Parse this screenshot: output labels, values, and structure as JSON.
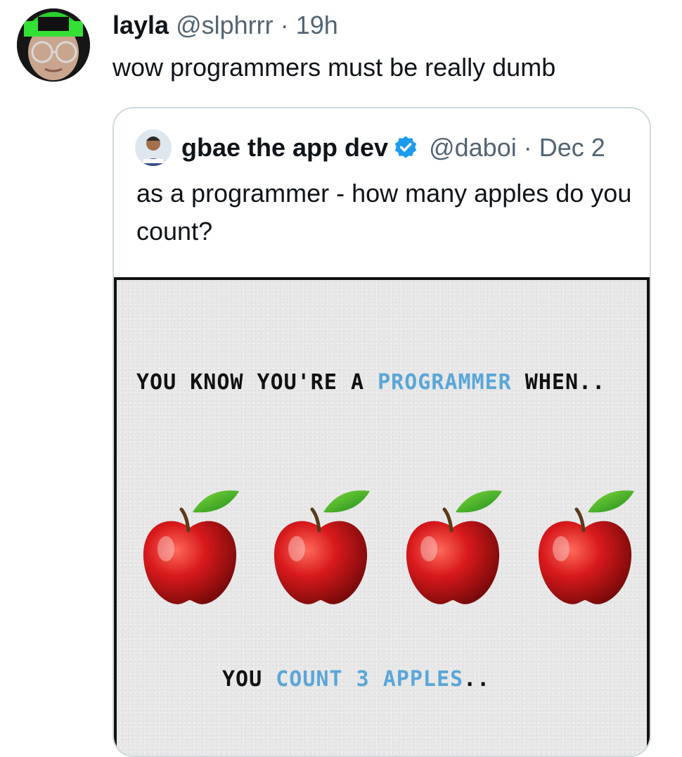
{
  "tweet": {
    "author_name": "layla",
    "author_handle": "@slphrrr",
    "separator": "·",
    "time": "19h",
    "text": "wow programmers must be really dumb"
  },
  "quote": {
    "author_name": "gbae the app dev",
    "author_handle": "@daboi",
    "separator": "·",
    "date": "Dec 2",
    "text": "as a programmer - how many apples do you count?",
    "verified": true,
    "verified_color": "#1d9bf0"
  },
  "image": {
    "headline": {
      "part1": "YOU KNOW YOU'RE A",
      "highlight": "PROGRAMMER",
      "part2": "WHEN.."
    },
    "apple_count_shown": 4,
    "footer": {
      "part1": "YOU",
      "highlight1": "COUNT",
      "highlight2": "3 APPLES",
      "part2": ".."
    },
    "highlight_color": "#5aa6d8"
  },
  "colors": {
    "text": "#0f1419",
    "meta": "#536471",
    "border": "#cfd9de"
  }
}
